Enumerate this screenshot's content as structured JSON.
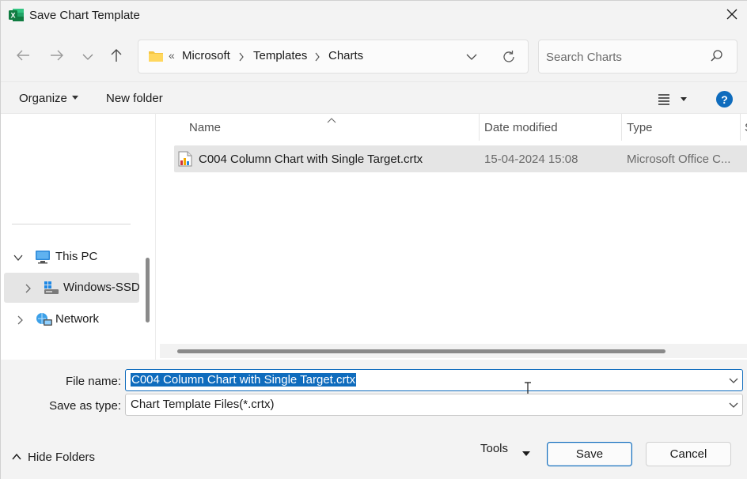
{
  "window": {
    "title": "Save Chart Template",
    "app_icon": "excel-icon",
    "close_icon": "close-icon"
  },
  "nav": {
    "back_icon": "arrow-left-icon",
    "forward_icon": "arrow-right-icon",
    "recent_icon": "chevron-down-icon",
    "up_icon": "arrow-up-icon",
    "address": {
      "overflow": "«",
      "crumbs": [
        "Microsoft",
        "Templates",
        "Charts"
      ]
    },
    "search_placeholder": "Search Charts"
  },
  "commands": {
    "organize": "Organize",
    "new_folder": "New folder",
    "view_icon": "list-view-icon",
    "help": "?"
  },
  "sidebar": {
    "items": [
      {
        "label": "This PC",
        "icon": "computer-icon",
        "expanded": true,
        "selected": false
      },
      {
        "label": "Windows-SSD",
        "icon": "drive-icon",
        "expanded": false,
        "selected": true
      },
      {
        "label": "Network",
        "icon": "network-icon",
        "expanded": false,
        "selected": false
      }
    ]
  },
  "filelist": {
    "columns": [
      "Name",
      "Date modified",
      "Type",
      "S"
    ],
    "rows": [
      {
        "name": "C004 Column Chart with Single Target.crtx",
        "date_modified": "15-04-2024 15:08",
        "type": "Microsoft Office C...",
        "icon": "chart-template-file-icon",
        "selected": true
      }
    ]
  },
  "form": {
    "file_name_label": "File name:",
    "file_name_value": "C004 Column Chart with Single Target.crtx",
    "save_as_type_label": "Save as type:",
    "save_as_type_value": "Chart Template Files(*.crtx)"
  },
  "footer": {
    "hide_folders": "Hide Folders",
    "tools": "Tools",
    "save": "Save",
    "cancel": "Cancel"
  },
  "colors": {
    "accent": "#0f6cbd",
    "selection": "#e5e5e5",
    "excel_green": "#107c41"
  }
}
